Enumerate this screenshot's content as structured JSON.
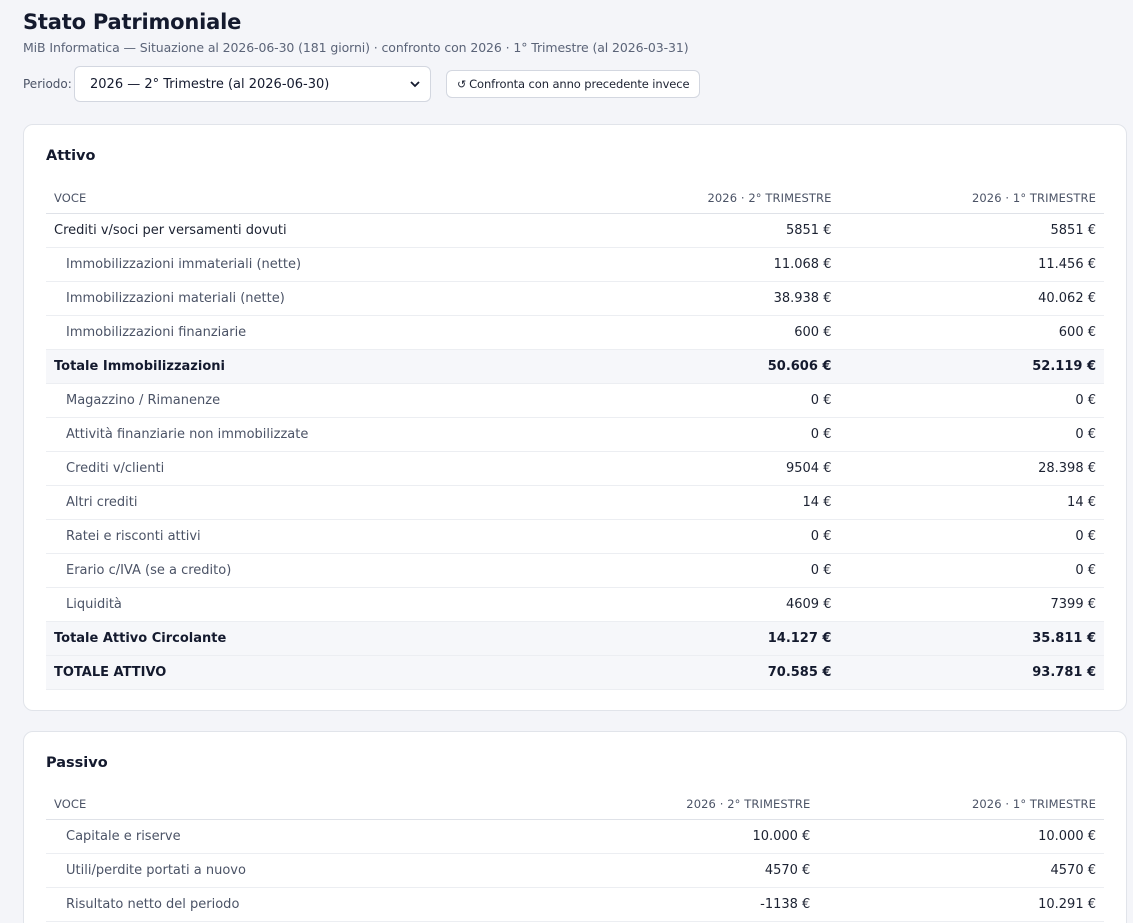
{
  "header": {
    "title": "Stato Patrimoniale",
    "subtitle": "MiB Informatica — Situazione al 2026-06-30 (181 giorni) · confronto con 2026 · 1° Trimestre (al 2026-03-31)"
  },
  "toolbar": {
    "period_label": "Periodo:",
    "period_selected": "2026 — 2° Trimestre (al 2026-06-30)",
    "compare_icon": "↺",
    "compare_label": "Confronta con anno precedente invece"
  },
  "attivo": {
    "title": "Attivo",
    "columns": [
      "Voce",
      "2026 · 2° Trimestre",
      "2026 · 1° Trimestre"
    ],
    "rows": [
      {
        "label": "Crediti v/soci per versamenti dovuti",
        "current": "5851 €",
        "previous": "5851 €"
      },
      {
        "label": "Immobilizzazioni immateriali (nette)",
        "current": "11.068 €",
        "previous": "11.456 €"
      },
      {
        "label": "Immobilizzazioni materiali (nette)",
        "current": "38.938 €",
        "previous": "40.062 €"
      },
      {
        "label": "Immobilizzazioni finanziarie",
        "current": "600 €",
        "previous": "600 €"
      },
      {
        "label": "Totale Immobilizzazioni",
        "current": "50.606 €",
        "previous": "52.119 €"
      },
      {
        "label": "Magazzino / Rimanenze",
        "current": "0 €",
        "previous": "0 €"
      },
      {
        "label": "Attività finanziarie non immobilizzate",
        "current": "0 €",
        "previous": "0 €"
      },
      {
        "label": "Crediti v/clienti",
        "current": "9504 €",
        "previous": "28.398 €"
      },
      {
        "label": "Altri crediti",
        "current": "14 €",
        "previous": "14 €"
      },
      {
        "label": "Ratei e risconti attivi",
        "current": "0 €",
        "previous": "0 €"
      },
      {
        "label": "Erario c/IVA (se a credito)",
        "current": "0 €",
        "previous": "0 €"
      },
      {
        "label": "Liquidità",
        "current": "4609 €",
        "previous": "7399 €"
      },
      {
        "label": "Totale Attivo Circolante",
        "current": "14.127 €",
        "previous": "35.811 €"
      },
      {
        "label": "TOTALE ATTIVO",
        "current": "70.585 €",
        "previous": "93.781 €"
      }
    ]
  },
  "passivo": {
    "title": "Passivo",
    "columns": [
      "Voce",
      "2026 · 2° Trimestre",
      "2026 · 1° Trimestre"
    ],
    "rows": [
      {
        "label": "Capitale e riserve",
        "current": "10.000 €",
        "previous": "10.000 €"
      },
      {
        "label": "Utili/perdite portati a nuovo",
        "current": "4570 €",
        "previous": "4570 €"
      },
      {
        "label": "Risultato netto del periodo",
        "current": "-1138 €",
        "previous": "10.291 €"
      }
    ]
  }
}
